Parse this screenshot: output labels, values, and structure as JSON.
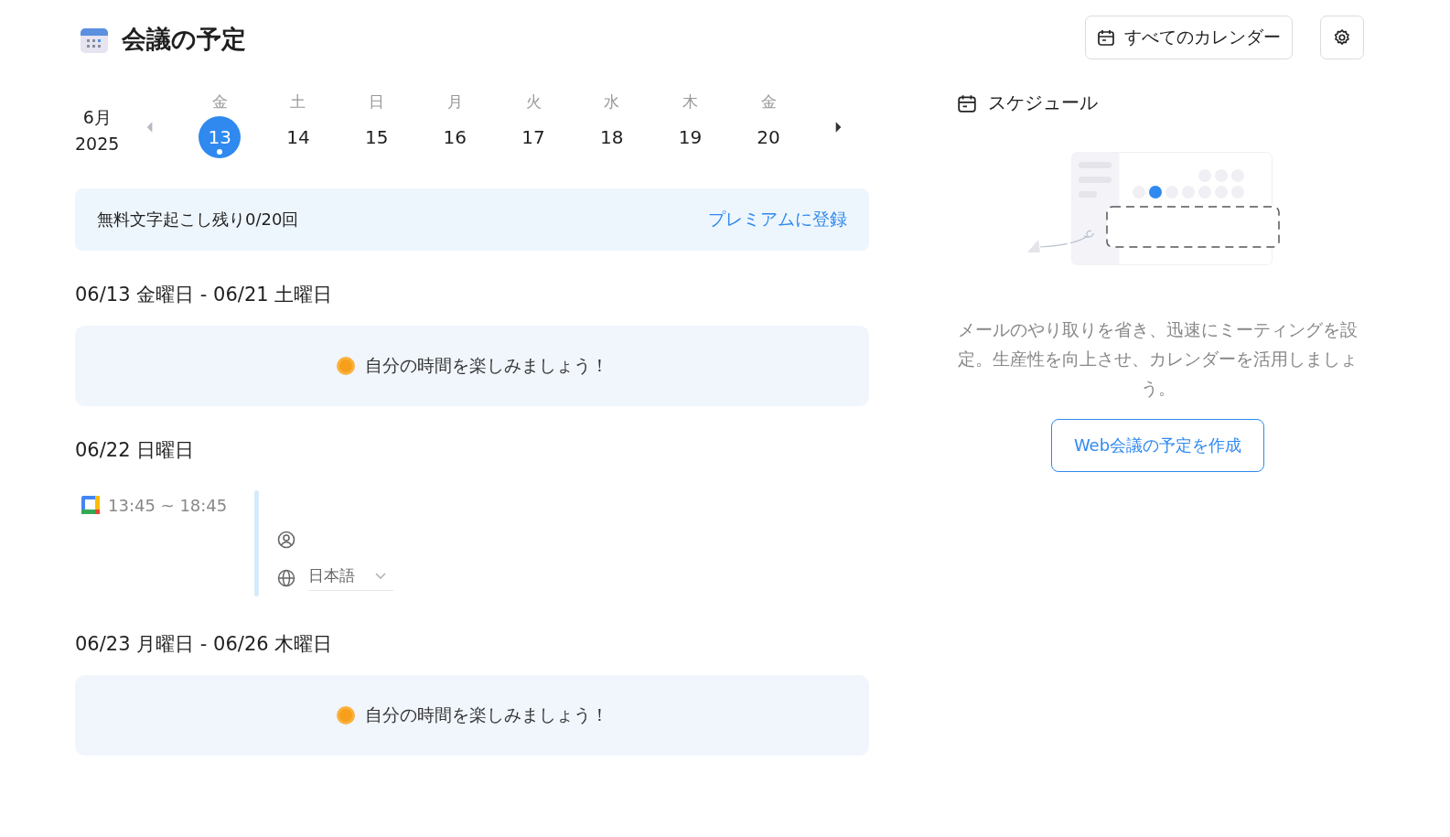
{
  "header": {
    "title": "会議の予定",
    "calendar_button": "すべてのカレンダー"
  },
  "week": {
    "month": "6月",
    "year": "2025",
    "days": [
      {
        "weekday": "金",
        "date": "13",
        "selected": true,
        "has_event": true
      },
      {
        "weekday": "土",
        "date": "14",
        "selected": false,
        "has_event": false
      },
      {
        "weekday": "日",
        "date": "15",
        "selected": false,
        "has_event": false
      },
      {
        "weekday": "月",
        "date": "16",
        "selected": false,
        "has_event": false
      },
      {
        "weekday": "火",
        "date": "17",
        "selected": false,
        "has_event": false
      },
      {
        "weekday": "水",
        "date": "18",
        "selected": false,
        "has_event": false
      },
      {
        "weekday": "木",
        "date": "19",
        "selected": false,
        "has_event": false
      },
      {
        "weekday": "金",
        "date": "20",
        "selected": false,
        "has_event": false
      }
    ]
  },
  "banner": {
    "text": "無料文字起こし残り0/20回",
    "link": "プレミアムに登録"
  },
  "sections": [
    {
      "kind": "free",
      "heading": "06/13 金曜日 - 06/21 土曜日",
      "message": "自分の時間を楽しみましょう！"
    },
    {
      "kind": "event",
      "heading": "06/22 日曜日",
      "time": "13:45 ~ 18:45",
      "language": "日本語"
    },
    {
      "kind": "free",
      "heading": "06/23 月曜日 - 06/26 木曜日",
      "message": "自分の時間を楽しみましょう！"
    }
  ],
  "schedule": {
    "title": "スケジュール",
    "description": "メールのやり取りを省き、迅速にミーティングを設定。生産性を向上させ、カレンダーを活用しましょう。",
    "button": "Web会議の予定を作成"
  }
}
